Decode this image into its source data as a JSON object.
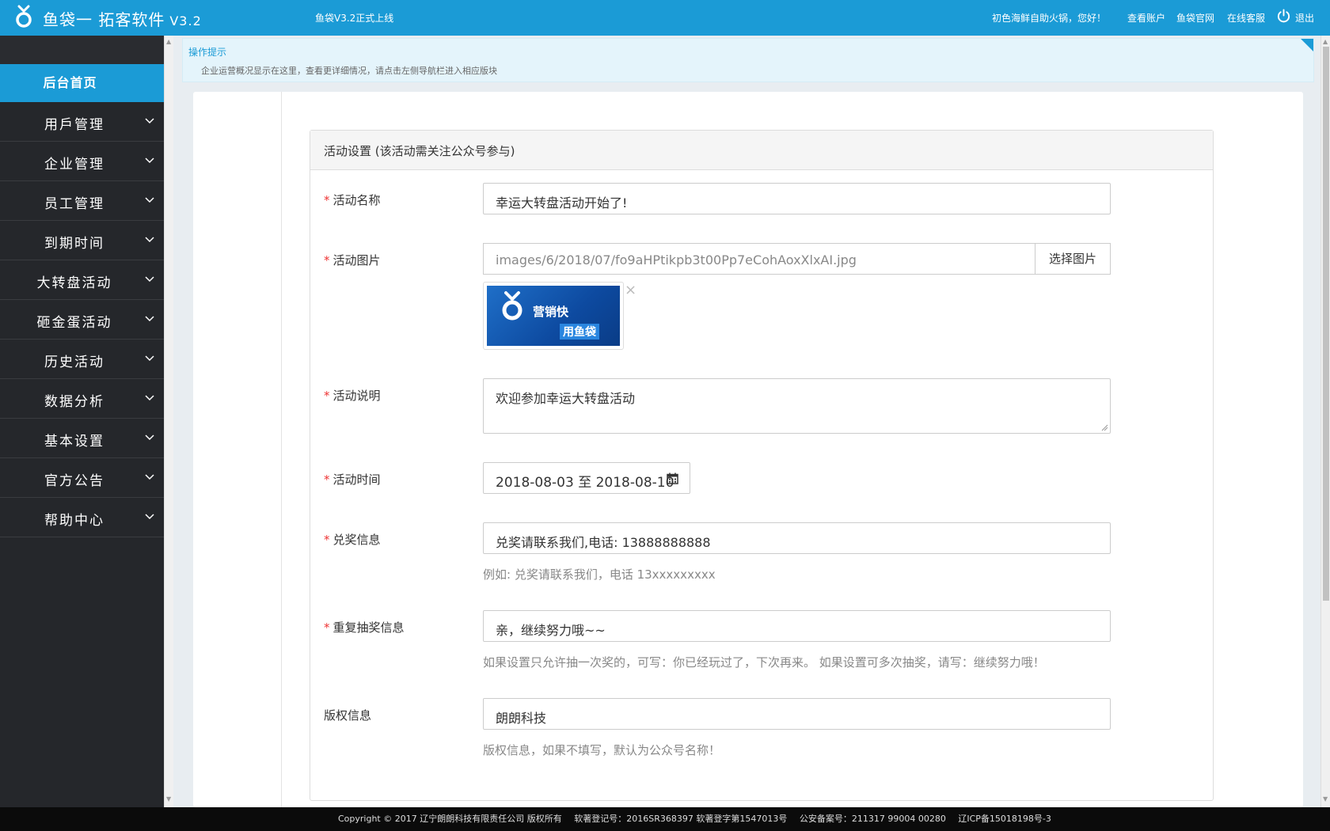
{
  "header": {
    "app_name": "鱼袋一 拓客软件",
    "version": "V3.2",
    "notice": "鱼袋V3.2正式上线",
    "greeting": "初色海鲜自助火锅，您好！",
    "links": [
      "查看账户",
      "鱼袋官网",
      "在线客服"
    ],
    "logout": "退出",
    "brand_color": "#1b9bd6"
  },
  "sidebar": {
    "home": "后台首页",
    "items": [
      {
        "label": "用戶管理"
      },
      {
        "label": "企业管理"
      },
      {
        "label": "员工管理"
      },
      {
        "label": "到期时间"
      },
      {
        "label": "大转盘活动"
      },
      {
        "label": "砸金蛋活动"
      },
      {
        "label": "历史活动"
      },
      {
        "label": "数据分析"
      },
      {
        "label": "基本设置"
      },
      {
        "label": "官方公告"
      },
      {
        "label": "帮助中心"
      }
    ]
  },
  "tip": {
    "title": "操作提示",
    "text": "企业运营概况显示在这里，查看更详细情况，请点击左侧导航栏进入相应版块"
  },
  "form": {
    "panel_title": "活动设置 (该活动需关注公众号参与)",
    "required_mark": "*",
    "name": {
      "label": "活动名称",
      "value": "幸运大转盘活动开始了!"
    },
    "image": {
      "label": "活动图片",
      "value": "images/6/2018/07/fo9aHPtikpb3t00Pp7eCohAoxXlxAI.jpg",
      "button": "选择图片",
      "thumb_text_1": "营销快",
      "thumb_text_2": "用鱼袋",
      "remove": "×"
    },
    "desc": {
      "label": "活动说明",
      "value": "欢迎参加幸运大转盘活动"
    },
    "time": {
      "label": "活动时间",
      "value": "2018-08-03 至 2018-08-10"
    },
    "prize": {
      "label": "兑奖信息",
      "value": "兑奖请联系我们,电话: 13888888888",
      "help": "例如: 兑奖请联系我们，电话 13xxxxxxxxx"
    },
    "repeat": {
      "label": "重复抽奖信息",
      "value": "亲，继续努力哦~~",
      "help": "如果设置只允许抽一次奖的，可写：你已经玩过了，下次再来。 如果设置可多次抽奖，请写：继续努力哦！"
    },
    "copyright": {
      "label": "版权信息",
      "value": "朗朗科技",
      "help": "版权信息，如果不填写，默认为公众号名称！"
    }
  },
  "footer": {
    "copyright": "Copyright © 2017 辽宁朗朗科技有限责任公司 版权所有",
    "soft_reg": "软著登记号：2016SR368397 软著登字第1547013号",
    "police": "公安备案号：211317 99004 00280",
    "icp": "辽ICP备15018198号-3"
  }
}
